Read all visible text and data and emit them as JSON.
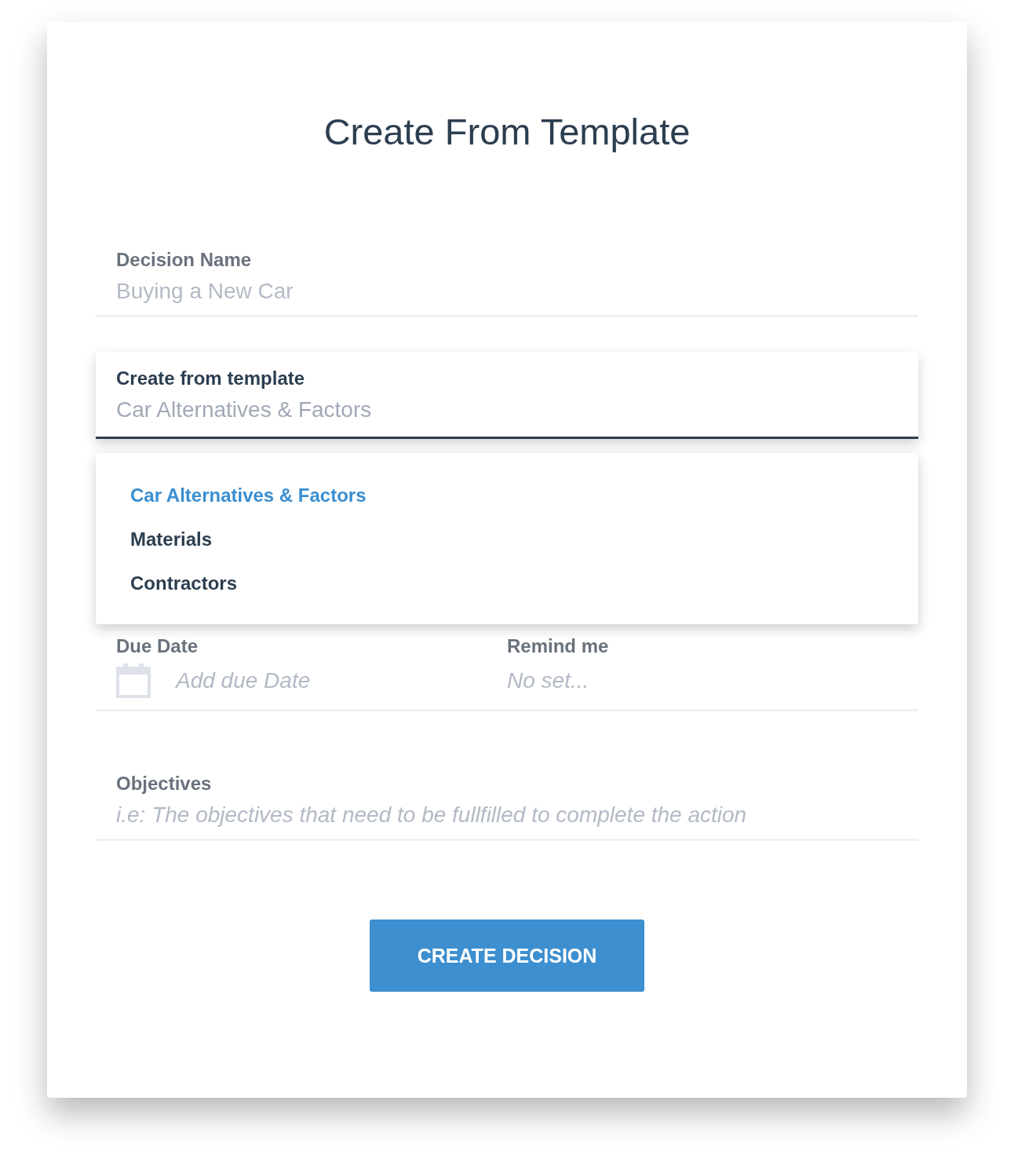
{
  "title": "Create From Template",
  "decision_name": {
    "label": "Decision Name",
    "placeholder": "Buying a New Car"
  },
  "template": {
    "label": "Create from template",
    "value": "Car Alternatives & Factors",
    "expanded": true
  },
  "template_options": [
    {
      "label": "Car Alternatives & Factors",
      "selected": true
    },
    {
      "label": "Materials",
      "selected": false
    },
    {
      "label": "Contractors",
      "selected": false
    }
  ],
  "due_date": {
    "label": "Due Date",
    "placeholder": "Add due Date"
  },
  "remind": {
    "label": "Remind me",
    "placeholder": "No set..."
  },
  "objectives": {
    "label": "Objectives",
    "placeholder": "i.e: The objectives that need to be fullfilled to complete the action"
  },
  "button": "CREATE DECISION"
}
